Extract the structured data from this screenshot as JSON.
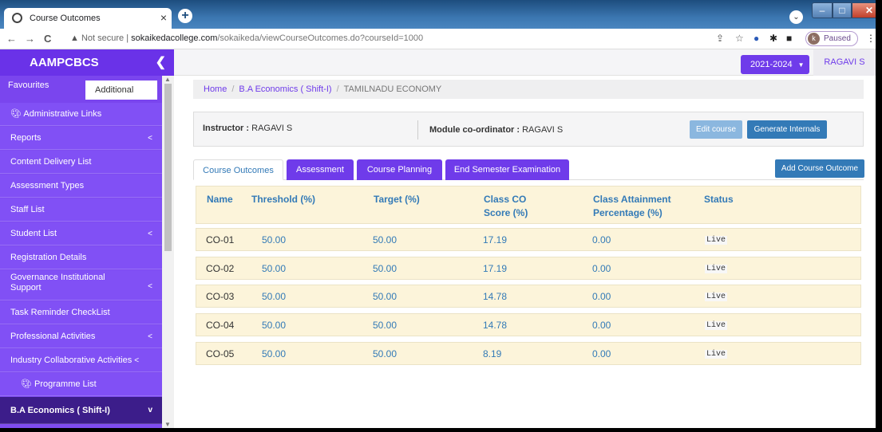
{
  "browser": {
    "tab_title": "Course Outcomes",
    "url_warning": "Not secure",
    "url_host": "sokaikedacollege.com",
    "url_path": "/sokaikeda/viewCourseOutcomes.do?courseId=1000",
    "profile_initial": "k",
    "profile_status": "Paused"
  },
  "sidebar": {
    "brand": "AAMPCBCS",
    "tabs": {
      "favourites": "Favourites",
      "additional": "Additional"
    },
    "items": [
      {
        "label": "Administrative Links",
        "icon": "dashboard-icon"
      },
      {
        "label": "Reports",
        "chevron": "<"
      },
      {
        "label": "Content Delivery List"
      },
      {
        "label": "Assessment Types"
      },
      {
        "label": "Staff List"
      },
      {
        "label": "Student List",
        "chevron": "<"
      },
      {
        "label": "Registration Details"
      },
      {
        "label": "Governance Institutional Support",
        "chevron": "<"
      },
      {
        "label": "Task Reminder CheckList"
      },
      {
        "label": "Professional Activities",
        "chevron": "<"
      },
      {
        "label": "Industry Collaborative Activities",
        "chevron": "<"
      },
      {
        "label": "Programme List",
        "icon": "dashboard-icon"
      },
      {
        "label": "B.A Economics ( Shift-I)",
        "chevron": "v"
      }
    ]
  },
  "header": {
    "year": "2021-2024",
    "user": "RAGAVI S"
  },
  "breadcrumb": {
    "home": "Home",
    "course": "B.A Economics ( Shift-I)",
    "current": "TAMILNADU ECONOMY"
  },
  "course_info": {
    "instructor_label": "Instructor :",
    "instructor": "RAGAVI S",
    "coordinator_label": "Module co-ordinator :",
    "coordinator": "RAGAVI S",
    "edit_button": "Edit course",
    "generate_button": "Generate Internals"
  },
  "tabs": [
    {
      "label": "Course Outcomes",
      "active": true
    },
    {
      "label": "Assessment"
    },
    {
      "label": "Course Planning"
    },
    {
      "label": "End Semester Examination"
    }
  ],
  "add_outcome_button": "Add Course Outcome",
  "table": {
    "headers": {
      "name": "Name",
      "threshold": "Threshold (%)",
      "target": "Target (%)",
      "score_line1": "Class CO",
      "score_line2": "Score (%)",
      "attain_line1": "Class Attainment",
      "attain_line2": "Percentage (%)",
      "status": "Status"
    },
    "rows": [
      {
        "name": "CO-01",
        "threshold": "50.00",
        "target": "50.00",
        "score": "17.19",
        "attainment": "0.00",
        "status": "Live"
      },
      {
        "name": "CO-02",
        "threshold": "50.00",
        "target": "50.00",
        "score": "17.19",
        "attainment": "0.00",
        "status": "Live"
      },
      {
        "name": "CO-03",
        "threshold": "50.00",
        "target": "50.00",
        "score": "14.78",
        "attainment": "0.00",
        "status": "Live"
      },
      {
        "name": "CO-04",
        "threshold": "50.00",
        "target": "50.00",
        "score": "14.78",
        "attainment": "0.00",
        "status": "Live"
      },
      {
        "name": "CO-05",
        "threshold": "50.00",
        "target": "50.00",
        "score": "8.19",
        "attainment": "0.00",
        "status": "Live"
      }
    ]
  },
  "colors": {
    "sidebar": "#8150f5",
    "accent": "#6f3bea",
    "link": "#337ab7",
    "row_bg": "#fcf4da"
  }
}
